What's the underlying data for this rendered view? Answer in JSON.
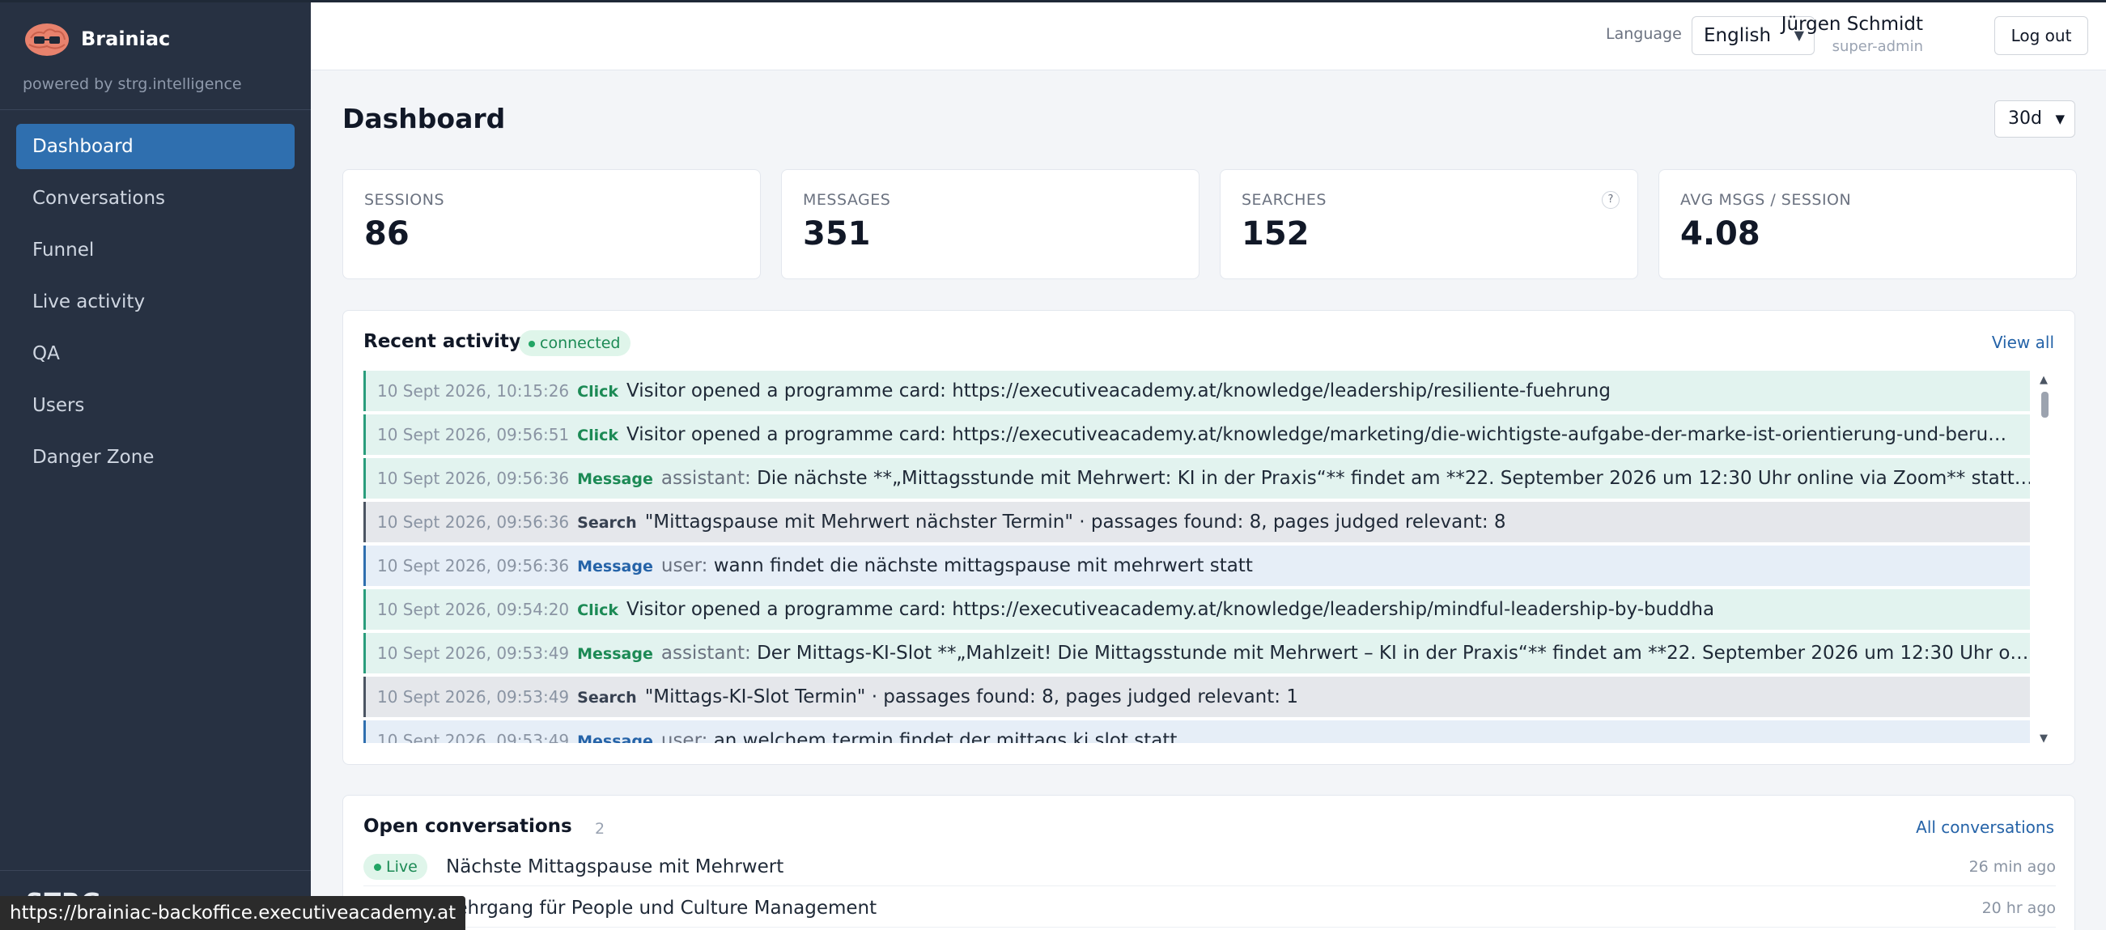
{
  "sidebar": {
    "brand": "Brainiac",
    "powered_by": "powered by strg.intelligence",
    "items": [
      {
        "label": "Dashboard",
        "active": true
      },
      {
        "label": "Conversations"
      },
      {
        "label": "Funnel"
      },
      {
        "label": "Live activity"
      },
      {
        "label": "QA"
      },
      {
        "label": "Users"
      },
      {
        "label": "Danger Zone"
      }
    ],
    "footer_logo": "STRG"
  },
  "status_url": "https://brainiac-backoffice.executiveacademy.at",
  "topbar": {
    "language_label": "Language",
    "language_value": "English",
    "user_name": "Jürgen Schmidt",
    "user_role": "super-admin",
    "logout_label": "Log out"
  },
  "main": {
    "title": "Dashboard",
    "range": "30d",
    "stats": [
      {
        "label": "SESSIONS",
        "value": "86"
      },
      {
        "label": "MESSAGES",
        "value": "351"
      },
      {
        "label": "SEARCHES",
        "value": "152",
        "help": "?"
      },
      {
        "label": "AVG MSGS / SESSION",
        "value": "4.08"
      }
    ],
    "activity": {
      "title": "Recent activity",
      "status": "connected",
      "view_all": "View all",
      "rows": [
        {
          "type": "click",
          "ts": "10 Sept 2026, 10:15:26",
          "kind": "Click",
          "role": "",
          "text": "Visitor opened a programme card: https://executiveacademy.at/knowledge/leadership/resiliente-fuehrung"
        },
        {
          "type": "click",
          "ts": "10 Sept 2026, 09:56:51",
          "kind": "Click",
          "role": "",
          "text": "Visitor opened a programme card: https://executiveacademy.at/knowledge/marketing/die-wichtigste-aufgabe-der-marke-ist-orientierung-und-beruhigung"
        },
        {
          "type": "assistant",
          "ts": "10 Sept 2026, 09:56:36",
          "kind": "Message",
          "role": "assistant:",
          "text": "Die nächste **„Mittagsstunde mit Mehrwert: KI in der Praxis“** findet am **22. September 2026 um 12:30 Uhr online via Zoom** statt. Als Exper..."
        },
        {
          "type": "search",
          "ts": "10 Sept 2026, 09:56:36",
          "kind": "Search",
          "role": "",
          "text": "\"Mittagspause mit Mehrwert nächster Termin\" · passages found: 8, pages judged relevant: 8"
        },
        {
          "type": "user",
          "ts": "10 Sept 2026, 09:56:36",
          "kind": "Message",
          "role": "user:",
          "text": "wann findet die nächste mittagspause mit mehrwert statt"
        },
        {
          "type": "click",
          "ts": "10 Sept 2026, 09:54:20",
          "kind": "Click",
          "role": "",
          "text": "Visitor opened a programme card: https://executiveacademy.at/knowledge/leadership/mindful-leadership-by-buddha"
        },
        {
          "type": "assistant",
          "ts": "10 Sept 2026, 09:53:49",
          "kind": "Message",
          "role": "assistant:",
          "text": "Der Mittags-KI-Slot **„Mahlzeit! Die Mittagsstunde mit Mehrwert – KI in der Praxis“** findet am **22. September 2026 um 12:30 Uhr online via Z..."
        },
        {
          "type": "search",
          "ts": "10 Sept 2026, 09:53:49",
          "kind": "Search",
          "role": "",
          "text": "\"Mittags-KI-Slot Termin\" · passages found: 8, pages judged relevant: 1"
        },
        {
          "type": "user",
          "ts": "10 Sept 2026, 09:53:49",
          "kind": "Message",
          "role": "user:",
          "text": "an welchem termin findet der mittags ki slot statt"
        }
      ]
    },
    "open_conversations": {
      "title": "Open conversations",
      "count": "2",
      "link": "All conversations",
      "rows": [
        {
          "badge": "Live",
          "title": "Nächste Mittagspause mit Mehrwert",
          "time": "26 min ago"
        },
        {
          "badge": "",
          "title": "Lehrgang für People und Culture Management",
          "time": "20 hr ago"
        }
      ]
    }
  },
  "colors": {
    "sidebar_bg": "#273142",
    "accent": "#2f6faf",
    "click_row": "#e2f3ef",
    "search_row": "#e5e7eb",
    "user_row": "#e6eef7",
    "success": "#1c8a55"
  }
}
